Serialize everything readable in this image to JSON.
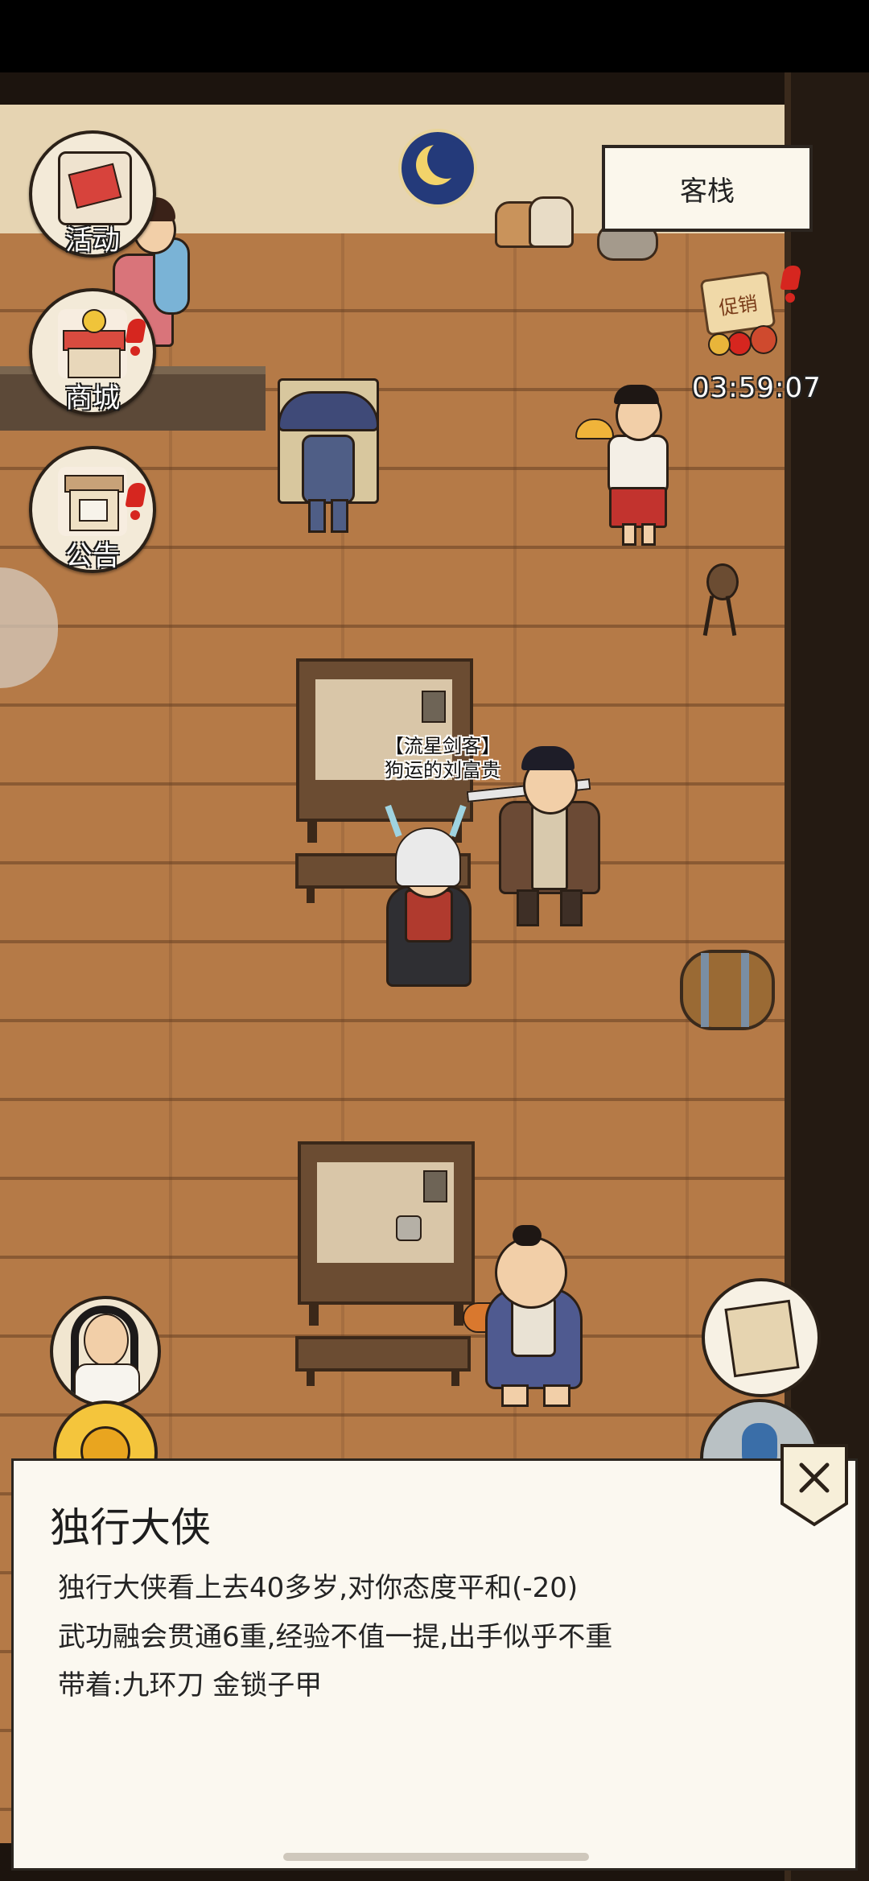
{
  "location_label": "客栈",
  "side_menu": [
    {
      "label": "活动",
      "icon": "activity-scroll-icon",
      "alert": false
    },
    {
      "label": "商城",
      "icon": "shop-stall-icon",
      "alert": true
    },
    {
      "label": "公告",
      "icon": "notice-board-icon",
      "alert": true
    }
  ],
  "promo": {
    "label": "促销",
    "timer": "03:59:07"
  },
  "npc_tag": {
    "title": "【流星剑客】",
    "name": "狗运的刘富贵"
  },
  "info_panel": {
    "title": "独行大侠",
    "lines": [
      "独行大侠看上去40多岁,对你态度平和(-20)",
      "武功融会贯通6重,经验不值一提,出手似乎不重",
      "带着:九环刀 金锁子甲"
    ],
    "close_icon": "close-icon"
  },
  "colors": {
    "floor": "#b57a47",
    "panel_bg": "#fbf8f0",
    "alert_red": "#d6261f"
  }
}
